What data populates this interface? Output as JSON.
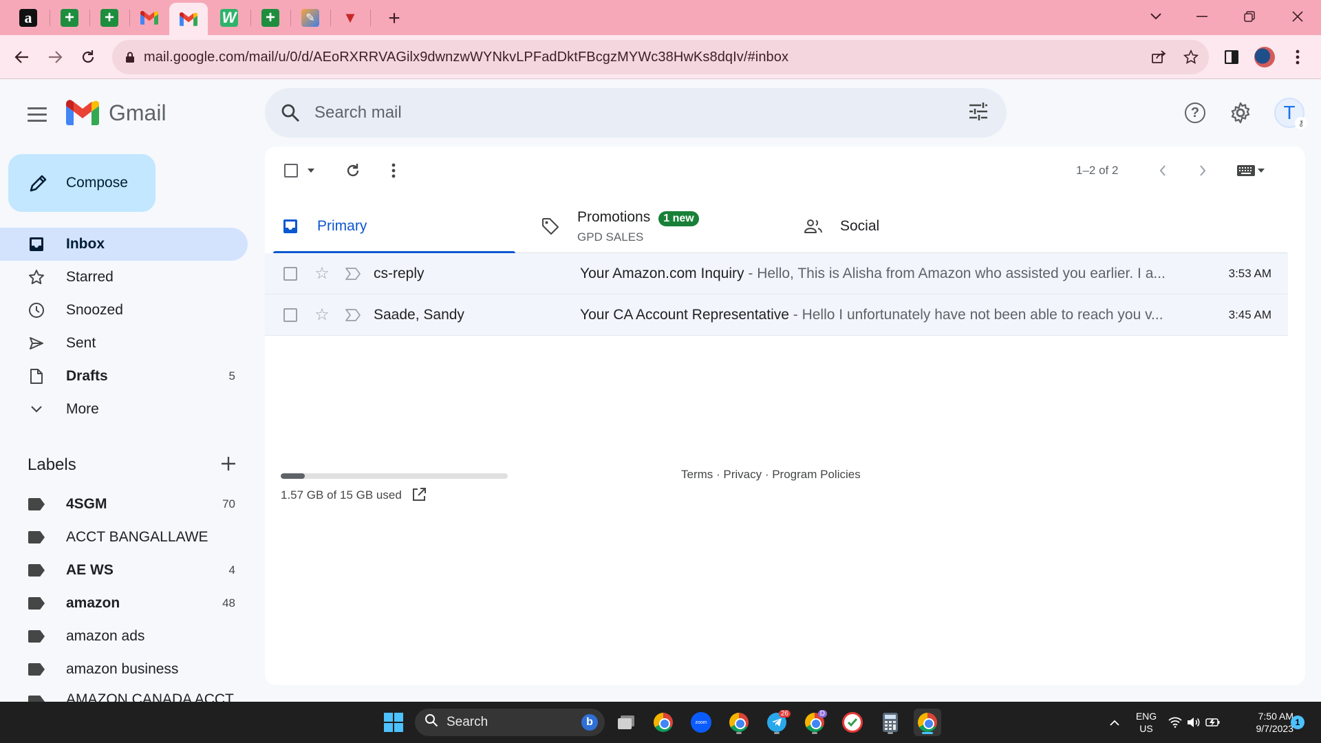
{
  "browser": {
    "tabs": [
      {
        "icon": "amazon-icon",
        "glyph": "a"
      },
      {
        "icon": "sheets-icon",
        "glyph": "+"
      },
      {
        "icon": "sheets-icon",
        "glyph": "+"
      },
      {
        "icon": "gmail-icon",
        "glyph": "M"
      },
      {
        "icon": "gmail-icon",
        "glyph": "M",
        "active": true
      },
      {
        "icon": "w-app-icon",
        "glyph": "W"
      },
      {
        "icon": "sheets-icon",
        "glyph": "+"
      },
      {
        "icon": "pen-app-icon",
        "glyph": "✎"
      },
      {
        "icon": "triangle-app-icon",
        "glyph": "▼"
      }
    ],
    "url": "mail.google.com/mail/u/0/d/AEoRXRRVAGilx9dwnzwWYNkvLPFadDktFBcgzMYWc38HwKs8dqIv/#inbox"
  },
  "header": {
    "app_name": "Gmail",
    "search_placeholder": "Search mail",
    "avatar_initial": "T"
  },
  "sidebar": {
    "compose_label": "Compose",
    "items": [
      {
        "label": "Inbox",
        "icon": "inbox-icon",
        "count": "",
        "bold": true,
        "active": true
      },
      {
        "label": "Starred",
        "icon": "star-icon",
        "count": ""
      },
      {
        "label": "Snoozed",
        "icon": "clock-icon",
        "count": ""
      },
      {
        "label": "Sent",
        "icon": "send-icon",
        "count": ""
      },
      {
        "label": "Drafts",
        "icon": "draft-icon",
        "count": "5",
        "bold": true
      },
      {
        "label": "More",
        "icon": "chevron-down-icon",
        "count": ""
      }
    ],
    "labels_title": "Labels",
    "labels": [
      {
        "label": "4SGM",
        "count": "70",
        "bold": true
      },
      {
        "label": "ACCT BANGALLAWE",
        "count": ""
      },
      {
        "label": "AE WS",
        "count": "4",
        "bold": true
      },
      {
        "label": "amazon",
        "count": "48",
        "bold": true
      },
      {
        "label": "amazon ads",
        "count": ""
      },
      {
        "label": "amazon business",
        "count": ""
      },
      {
        "label": "AMAZON CANADA ACCT",
        "count": ""
      }
    ]
  },
  "toolbar": {
    "pager": "1–2 of 2"
  },
  "categories": {
    "primary": "Primary",
    "promotions": "Promotions",
    "promotions_badge": "1 new",
    "promotions_sub": "GPD SALES",
    "social": "Social"
  },
  "emails": [
    {
      "sender": "cs-reply",
      "subject": "Your Amazon.com Inquiry",
      "snippet": " - Hello, This is Alisha from Amazon who assisted you earlier. I a...",
      "time": "3:53 AM"
    },
    {
      "sender": "Saade, Sandy",
      "subject": "Your CA Account Representative",
      "snippet": " - Hello I unfortunately have not been able to reach you v...",
      "time": "3:45 AM"
    }
  ],
  "footer": {
    "storage_text": "1.57 GB of 15 GB used",
    "storage_fraction": 0.105,
    "links": "Terms · Privacy · Program Policies"
  },
  "taskbar": {
    "search_label": "Search",
    "lang_top": "ENG",
    "lang_bottom": "US",
    "time": "7:50 AM",
    "date": "9/7/2023",
    "telegram_badge": "26",
    "notification_count": "1",
    "chrome_profile_badge": "D"
  },
  "colors": {
    "tabbar": "#f7a8b8",
    "accent_blue": "#0b57d0",
    "compose_bg": "#c2e7ff",
    "inbox_active": "#d3e3fd",
    "promo_badge": "#188038"
  }
}
